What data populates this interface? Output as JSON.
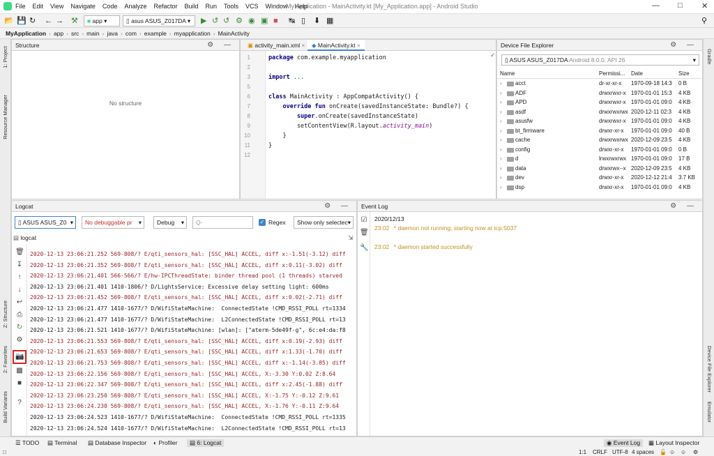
{
  "menu": [
    "File",
    "Edit",
    "View",
    "Navigate",
    "Code",
    "Analyze",
    "Refactor",
    "Build",
    "Run",
    "Tools",
    "VCS",
    "Window",
    "Help"
  ],
  "window_title": "My Application - MainActivity.kt [My_Application.app] - Android Studio",
  "toolbar": {
    "run_config": "app",
    "device": "asus ASUS_Z017DA"
  },
  "breadcrumbs": [
    "MyApplication",
    "app",
    "src",
    "main",
    "java",
    "com",
    "example",
    "myapplication",
    "MainActivity"
  ],
  "left_strip": {
    "project": "1: Project",
    "resource_manager": "Resource Manager",
    "structure": "Z: Structure",
    "favorites": "2: Favorites",
    "build_variants": "Build Variants"
  },
  "right_strip": {
    "gradle": "Gradle",
    "device_file_explorer": "Device File Explorer",
    "emulator": "Emulator"
  },
  "structure": {
    "title": "Structure",
    "empty": "No structure"
  },
  "editor": {
    "tabs": [
      "activity_main.xml",
      "MainActivity.kt"
    ],
    "lines": [
      {
        "n": "1",
        "code": [
          {
            "t": "package ",
            "c": "kw"
          },
          {
            "t": "com.example.myapplication",
            "c": ""
          }
        ]
      },
      {
        "n": "2",
        "code": []
      },
      {
        "n": "3",
        "code": [
          {
            "t": "import ",
            "c": "kw"
          },
          {
            "t": "...",
            "c": "fn"
          }
        ]
      },
      {
        "n": "5",
        "code": []
      },
      {
        "n": "6",
        "code": [
          {
            "t": "class ",
            "c": "kw"
          },
          {
            "t": "MainActivity : AppCompatActivity() {",
            "c": ""
          }
        ]
      },
      {
        "n": "7",
        "code": [
          {
            "t": "    override fun ",
            "c": "kw"
          },
          {
            "t": "onCreate(savedInstanceState: Bundle?) {",
            "c": ""
          }
        ]
      },
      {
        "n": "8",
        "code": [
          {
            "t": "        super",
            "c": "kw"
          },
          {
            "t": ".onCreate(savedInstanceState)",
            "c": ""
          }
        ]
      },
      {
        "n": "9",
        "code": [
          {
            "t": "        setContentView(R.layout.",
            "c": ""
          },
          {
            "t": "activity_main",
            "c": "it"
          },
          {
            "t": ")",
            "c": ""
          }
        ]
      },
      {
        "n": "10",
        "code": [
          {
            "t": "    }",
            "c": ""
          }
        ]
      },
      {
        "n": "11",
        "code": [
          {
            "t": "}",
            "c": ""
          }
        ]
      },
      {
        "n": "12",
        "code": []
      }
    ]
  },
  "dfe": {
    "title": "Device File Explorer",
    "device": "ASUS ASUS_Z017DA",
    "device_sub": "Android 8.0.0, API 26",
    "columns": [
      "Name",
      "Permissi...",
      "Date",
      "Size"
    ],
    "rows": [
      [
        "acct",
        "dr-xr-xr-x",
        "1970-09-18 14:3",
        "0 B"
      ],
      [
        "ADF",
        "drwxrwxr-x",
        "1970-01-01 15:3",
        "4 KB"
      ],
      [
        "APD",
        "drwxrwxr-x",
        "1970-01-01 09:0",
        "4 KB"
      ],
      [
        "asdf",
        "drwxrwxrwx",
        "2020-12-11 02:3",
        "4 KB"
      ],
      [
        "asusfw",
        "drwxrwxr-x",
        "1970-01-01 09:0",
        "4 KB"
      ],
      [
        "bt_firmware",
        "drwxr-xr-x",
        "1970-01-01 09:0",
        "40 B"
      ],
      [
        "cache",
        "drwxrwxrwx",
        "2020-12-09 23:5",
        "4 KB"
      ],
      [
        "config",
        "drwxr-xr-x",
        "1970-01-01 09:0",
        "0 B"
      ],
      [
        "d",
        "lrwxrwxrwx",
        "1970-01-01 09:0",
        "17 B"
      ],
      [
        "data",
        "drwxrwx--x",
        "2020-12-09 23:5",
        "4 KB"
      ],
      [
        "dev",
        "drwxr-xr-x",
        "2020-12-12 21:4",
        "3.7 KB"
      ],
      [
        "dsp",
        "drwxr-xr-x",
        "1970-01-01 09:0",
        "4 KB"
      ]
    ]
  },
  "logcat": {
    "title": "Logcat",
    "device": "ASUS ASUS_Z0",
    "process": "No debuggable pr",
    "level": "Debug",
    "search_placeholder": "Q-",
    "regex": "Regex",
    "filter": "Show only selectec",
    "tab": "logcat",
    "lines": [
      {
        "t": "2020-12-13 23:06:21.252 569-808/? E/qti_sensors_hal: [SSC_HAL] ACCEL, diff x:-1.51(-3.12) diff",
        "c": "err"
      },
      {
        "t": "2020-12-13 23:06:21.352 569-808/? E/qti_sensors_hal: [SSC_HAL] ACCEL, diff x:0.11(-3.02) diff",
        "c": "err"
      },
      {
        "t": "2020-12-13 23:06:21.401 566-566/? E/hw-IPCThreadState: binder thread pool (1 threads) starved",
        "c": "err"
      },
      {
        "t": "2020-12-13 23:06:21.401 1410-1806/? D/LightsService: Excessive delay setting light: 600ms",
        "c": "dbg"
      },
      {
        "t": "2020-12-13 23:06:21.452 569-808/? E/qti_sensors_hal: [SSC_HAL] ACCEL, diff x:0.02(-2.71) diff",
        "c": "err"
      },
      {
        "t": "2020-12-13 23:06:21.477 1410-1677/? D/WifiStateMachine:  ConnectedState !CMD_RSSI_POLL rt=1334",
        "c": "dbg"
      },
      {
        "t": "2020-12-13 23:06:21.477 1410-1677/? D/WifiStateMachine:  L2ConnectedState !CMD_RSSI_POLL rt=13",
        "c": "dbg"
      },
      {
        "t": "2020-12-13 23:06:21.521 1410-1677/? D/WifiStateMachine: [wlan]: [\"aterm-5de49f-g\", 6c:e4:da:f8",
        "c": "dbg"
      },
      {
        "t": "2020-12-13 23:06:21.553 569-808/? E/qti_sensors_hal: [SSC_HAL] ACCEL, diff x:0.19(-2.93) diff",
        "c": "err"
      },
      {
        "t": "2020-12-13 23:06:21.653 569-808/? E/qti_sensors_hal: [SSC_HAL] ACCEL, diff x:1.33(-1.70) diff",
        "c": "err"
      },
      {
        "t": "2020-12-13 23:06:21.753 569-808/? E/qti_sensors_hal: [SSC_HAL] ACCEL, diff x:-1.14(-3.85) diff",
        "c": "err"
      },
      {
        "t": "2020-12-13 23:06:22.156 569-808/? E/qti_sensors_hal: [SSC_HAL] ACCEL, X:-3.30 Y:0.02 Z:8.64",
        "c": "err"
      },
      {
        "t": "2020-12-13 23:06:22.347 569-808/? E/qti_sensors_hal: [SSC_HAL] ACCEL, diff x:2.45(-1.88) diff",
        "c": "err"
      },
      {
        "t": "2020-12-13 23:06:23.250 569-808/? E/qti_sensors_hal: [SSC_HAL] ACCEL, X:-1.75 Y:-0.12 Z:9.61",
        "c": "err"
      },
      {
        "t": "2020-12-13 23:06:24.230 569-808/? E/qti_sensors_hal: [SSC_HAL] ACCEL, X:-1.76 Y:-0.11 Z:9.64",
        "c": "err"
      },
      {
        "t": "2020-12-13 23:06:24.523 1410-1677/? D/WifiStateMachine:  ConnectedState !CMD_RSSI_POLL rt=1335",
        "c": "dbg"
      },
      {
        "t": "2020-12-13 23:06:24.524 1410-1677/? D/WifiStateMachine:  L2ConnectedState !CMD_RSSI_POLL rt=13",
        "c": "dbg"
      },
      {
        "t": "2020-12-13 23:06:24.573 1410-1677/? D/WifiStateMachine: [wlan]: [\"aterm-5de49f-g\", 6c:e4:da:f8",
        "c": "dbg"
      }
    ]
  },
  "event_log": {
    "title": "Event Log",
    "date": "2020/12/13",
    "entries": [
      {
        "time": "23:02",
        "msg": "* daemon not running; starting now at tcp:5037"
      },
      {
        "time": "23:02",
        "msg": "* daemon started successfully"
      }
    ]
  },
  "bottom_tabs": [
    "TODO",
    "Terminal",
    "Database Inspector",
    "Profiler",
    "6: Logcat"
  ],
  "bottom_right_tabs": [
    "Event Log",
    "Layout Inspector"
  ],
  "status": {
    "pos": "1:1",
    "eol": "CRLF",
    "enc": "UTF-8",
    "indent": "4 spaces"
  },
  "colors": {
    "accent": "#4083c9",
    "error_text": "#9b2226",
    "highlight_box": "#e02020"
  }
}
